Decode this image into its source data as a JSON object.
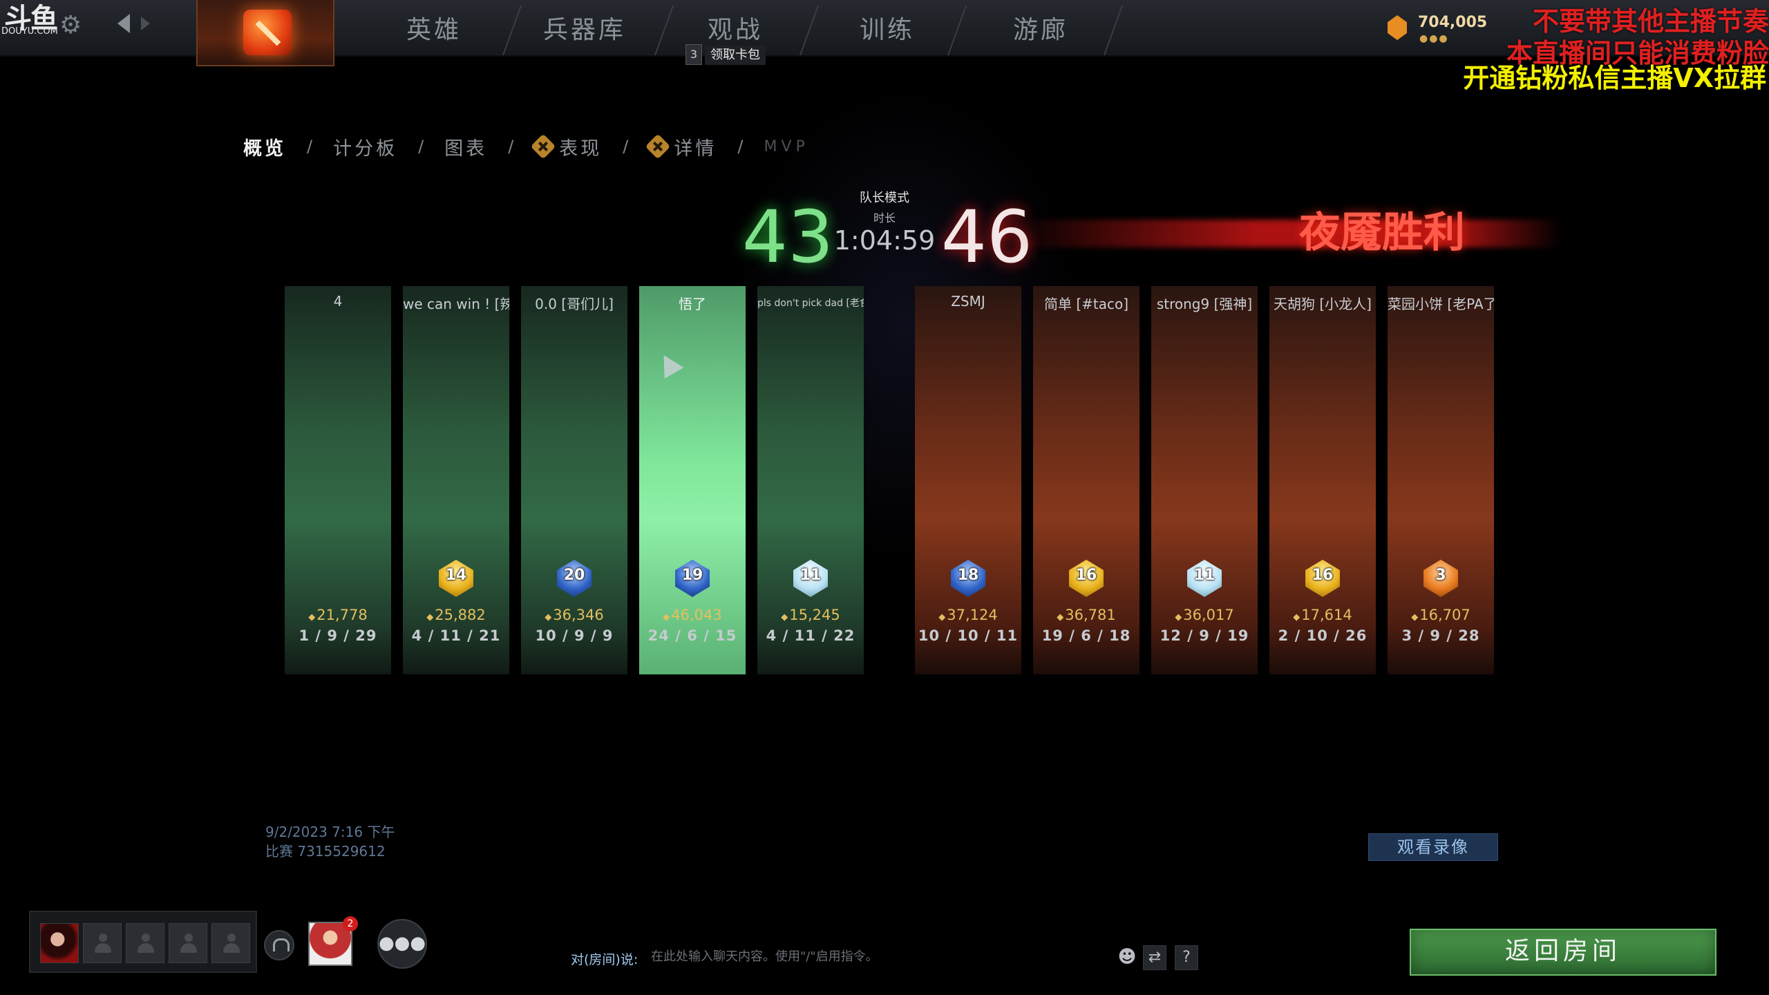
{
  "watermark": {
    "cn": "斗鱼",
    "en": "DOUYU.COM"
  },
  "nav": {
    "tabs": [
      "英雄",
      "兵器库",
      "观战",
      "训练",
      "游廊"
    ],
    "badge_count": "3",
    "badge_label": "领取卡包"
  },
  "currency": {
    "shards": "704,005",
    "dots": "●●●"
  },
  "overlay": {
    "line1": "不要带其他主播节奏",
    "line2": "本直播间只能消费粉脸",
    "line3": "开通钻粉私信主播VX拉群"
  },
  "subtabs": {
    "overview": "概览",
    "scoreboard": "计分板",
    "graphs": "图表",
    "performance": "表现",
    "details": "详情",
    "mvp": "MVP",
    "separator": "/"
  },
  "match": {
    "mode": "队长模式",
    "duration_label": "时长",
    "duration": "1:04:59",
    "radiant_score": "43",
    "dire_score": "46",
    "victory": "夜魇胜利",
    "date": "9/2/2023 7:16 下午",
    "id": "比赛 7315529612"
  },
  "players": [
    {
      "name": "4",
      "rank": "",
      "medal": "none",
      "net_worth": "21,778",
      "kda": "1 / 9 / 29",
      "team": "radiant"
    },
    {
      "name": "we can win ! [辣辣辣]",
      "rank": "14",
      "medal": "gold",
      "net_worth": "25,882",
      "kda": "4 / 11 / 21",
      "team": "radiant"
    },
    {
      "name": "0.0 [哥们儿]",
      "rank": "20",
      "medal": "blue",
      "net_worth": "36,346",
      "kda": "10 / 9 / 9",
      "team": "radiant"
    },
    {
      "name": "悟了",
      "rank": "19",
      "medal": "blue",
      "net_worth": "46,043",
      "kda": "24 / 6 / 15",
      "team": "radiant",
      "highlight": true
    },
    {
      "name": "pls don't pick dad [老食客]",
      "rank": "11",
      "medal": "diamond",
      "net_worth": "15,245",
      "kda": "4 / 11 / 22",
      "team": "radiant"
    },
    {
      "name": "ZSMJ",
      "rank": "18",
      "medal": "blue",
      "net_worth": "37,124",
      "kda": "10 / 10 / 11",
      "team": "dire"
    },
    {
      "name": "简单 [#taco]",
      "rank": "16",
      "medal": "gold",
      "net_worth": "36,781",
      "kda": "19 / 6 / 18",
      "team": "dire"
    },
    {
      "name": "strong9 [强神]",
      "rank": "11",
      "medal": "diamond",
      "net_worth": "36,017",
      "kda": "12 / 9 / 19",
      "team": "dire"
    },
    {
      "name": "天胡狗 [小龙人]",
      "rank": "16",
      "medal": "gold",
      "net_worth": "17,614",
      "kda": "2 / 10 / 26",
      "team": "dire"
    },
    {
      "name": "菜园小饼 [老PA了]",
      "rank": "3",
      "medal": "orange",
      "net_worth": "16,707",
      "kda": "3 / 9 / 28",
      "team": "dire"
    }
  ],
  "footer": {
    "watch_replay": "观看录像",
    "friend_badge": "2",
    "chat_prefix": "对(房间)说:",
    "chat_placeholder": "在此处输入聊天内容。使用\"/\"启用指令。",
    "help": "?",
    "return_lobby": "返回房间"
  },
  "colors": {
    "radiant": "#7fe08a",
    "dire": "#ff5b4a",
    "gold": "#e4bf5f",
    "medal_gold": "#e9b11c",
    "medal_blue": "#2f63c7",
    "medal_diamond": "#b9e2f4",
    "medal_orange": "#e87a1e"
  }
}
